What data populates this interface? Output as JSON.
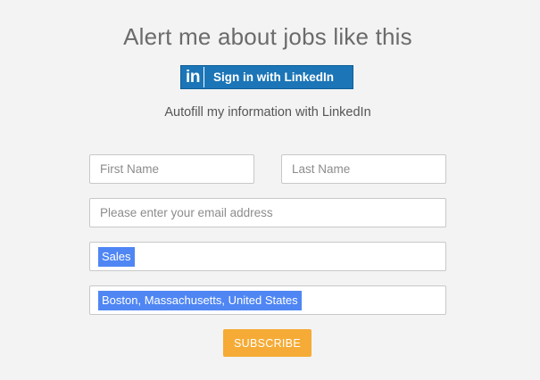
{
  "header": {
    "title": "Alert me about jobs like this"
  },
  "linkedin": {
    "logo_text": "in",
    "button_label": "Sign in with LinkedIn",
    "brand_color": "#1b75b7",
    "autofill_text": "Autofill my information with LinkedIn"
  },
  "form": {
    "first_name": {
      "placeholder": "First Name",
      "value": ""
    },
    "last_name": {
      "placeholder": "Last Name",
      "value": ""
    },
    "email": {
      "placeholder": "Please enter your email address",
      "value": ""
    },
    "keyword_tag": "Sales",
    "location_tag": "Boston, Massachusetts, United States",
    "tag_color": "#4f86f4",
    "subscribe_label": "SUBSCRIBE",
    "subscribe_color": "#f5ab35"
  }
}
